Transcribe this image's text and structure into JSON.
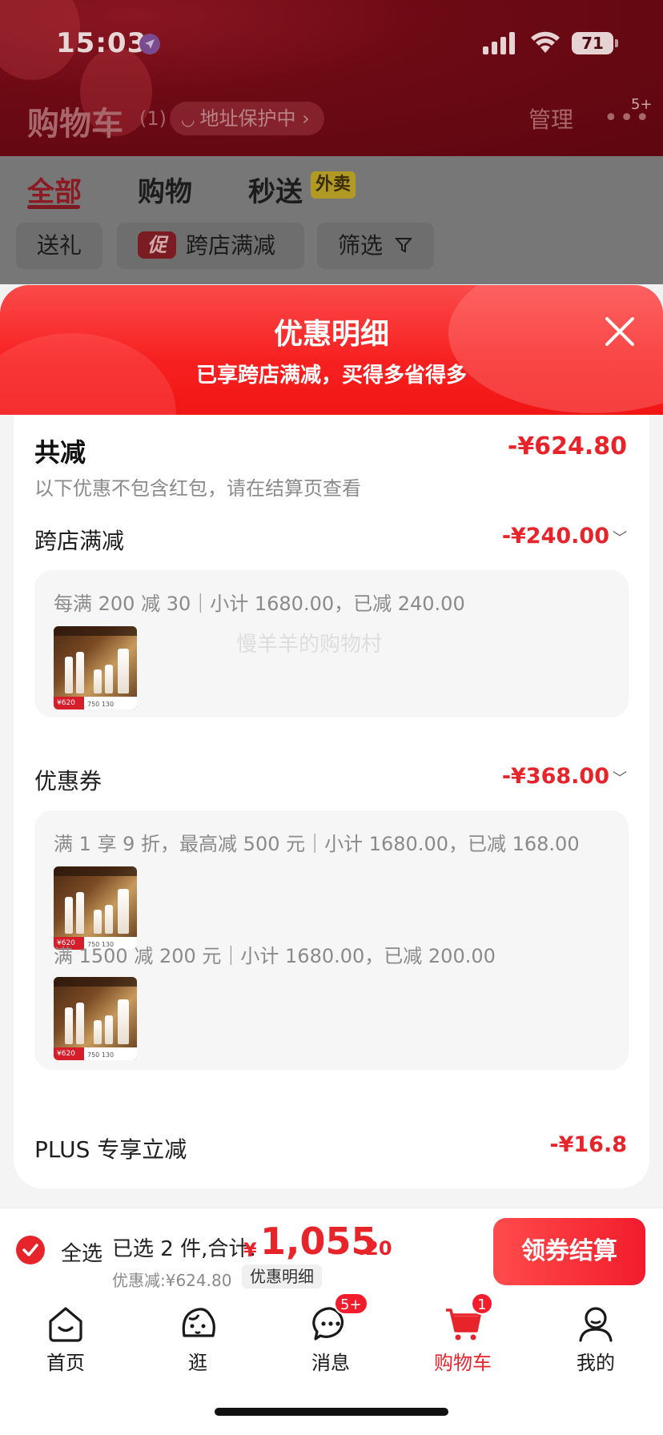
{
  "status_bar": {
    "time": "15:03",
    "battery": "71"
  },
  "header": {
    "title": "购物车",
    "count": "(1)",
    "address_pill": "地址保护中 ›",
    "manage": "管理",
    "more_badge": "5+"
  },
  "tabs": [
    {
      "label": "全部",
      "active": true
    },
    {
      "label": "购物"
    },
    {
      "label": "秒送",
      "badge": "外卖"
    }
  ],
  "filters": {
    "gift": "送礼",
    "promo_tag": "促",
    "cross_store": "跨店满减",
    "filter": "筛选"
  },
  "sheet": {
    "title": "优惠明细",
    "subtitle": "已享跨店满减，买得多省得多",
    "total_label": "共减",
    "total_amount": "-¥624.80",
    "note": "以下优惠不包含红包，请在结算页查看",
    "watermark": "慢羊羊的购物村",
    "sections": {
      "cross_store": {
        "label": "跨店满减",
        "amount": "-¥240.00",
        "detail": "每满 200 减 30｜小计 1680.00，已减 240.00"
      },
      "coupon": {
        "label": "优惠券",
        "amount": "-¥368.00",
        "detail_1": "满 1 享 9 折，最高减 500 元｜小计 1680.00，已减 168.00",
        "detail_2": "满 1500 减 200 元｜小计 1680.00，已减 200.00"
      },
      "plus": {
        "label": "PLUS 专享立减",
        "amount": "-¥16.8"
      }
    },
    "thumb_prices": {
      "red": "¥620",
      "mid": "750",
      "right": "130"
    }
  },
  "checkout": {
    "select_all": "全选",
    "selected": "已选 2 件,合计:",
    "currency": "¥",
    "price_int": "1,055",
    "price_dec": ".20",
    "discount": "优惠减:¥624.80",
    "detail_link": "优惠明细",
    "button": "领券结算"
  },
  "tabbar": {
    "items": [
      {
        "label": "首页",
        "icon": "home-icon"
      },
      {
        "label": "逛",
        "icon": "stroll-face-icon"
      },
      {
        "label": "消息",
        "icon": "message-icon",
        "badge": "5+"
      },
      {
        "label": "购物车",
        "icon": "cart-icon",
        "badge": "1",
        "active": true
      },
      {
        "label": "我的",
        "icon": "profile-icon"
      }
    ]
  },
  "colors": {
    "accent": "#e8242b",
    "header_bg": "#6d0a14"
  }
}
